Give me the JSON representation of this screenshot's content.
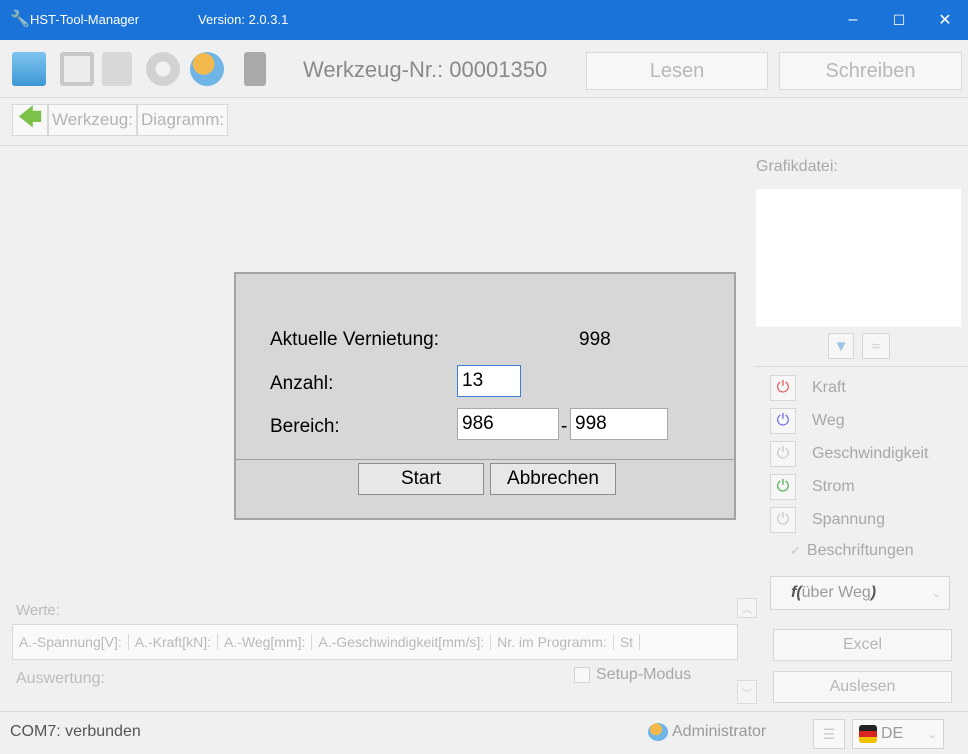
{
  "window": {
    "app_name": "HST-Tool-Manager",
    "version": "Version: 2.0.3.1",
    "minimize": "–",
    "maximize": "☐",
    "close": "✕",
    "accent": "#1a73d9"
  },
  "toolbar": {
    "tool_number": "Werkzeug-Nr.: 00001350",
    "read_label": "Lesen",
    "write_label": "Schreiben"
  },
  "breadcrumb": {
    "items": [
      "Werkzeug:",
      "Diagramm:"
    ]
  },
  "right_panel": {
    "graphic_file_label": "Grafikdatei:",
    "signals": [
      {
        "name": "Kraft",
        "color": "#e05a5a"
      },
      {
        "name": "Weg",
        "color": "#6b6bea"
      },
      {
        "name": "Geschwindigkeit",
        "color": "#c8c8c8"
      },
      {
        "name": "Strom",
        "color": "#4caf50"
      },
      {
        "name": "Spannung",
        "color": "#c8c8c8"
      }
    ],
    "labels_checkbox": "Beschriftungen",
    "function_prefix": "f(",
    "function_text": " über Weg ",
    "function_suffix": ")",
    "excel_label": "Excel",
    "readout_label": "Auslesen"
  },
  "dialog": {
    "current_label": "Aktuelle Vernietung:",
    "current_value": "998",
    "count_label": "Anzahl:",
    "count_value": "13",
    "range_label": "Bereich:",
    "range_from": "986",
    "range_sep": "-",
    "range_to": "998",
    "start_label": "Start",
    "cancel_label": "Abbrechen"
  },
  "values": {
    "label": "Werte:",
    "columns": [
      "A.-Spannung[V]:",
      "A.-Kraft[kN]:",
      "A.-Weg[mm]:",
      "A.-Geschwindigkeit[mm/s]:",
      "Nr. im Programm:",
      "St"
    ]
  },
  "evaluation": {
    "label": "Auswertung:",
    "setup_mode": "Setup-Modus"
  },
  "status": {
    "connection": "COM7: verbunden",
    "user": "Administrator",
    "language": "DE"
  }
}
